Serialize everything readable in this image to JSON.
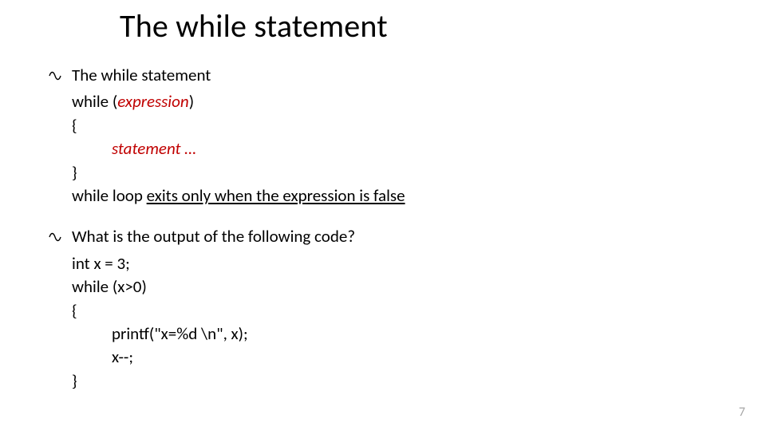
{
  "title": "The while statement",
  "bullets": {
    "b1": {
      "marker": "☐",
      "marker_glyph": "d",
      "text": "The while statement"
    },
    "b2": {
      "marker_glyph": "d",
      "text": "What is the output of the following code?"
    }
  },
  "syntax": {
    "while_open": "while (",
    "expression": "expression",
    "while_close": ")",
    "brace_open": "{",
    "statement_line": "statement …",
    "brace_close": "}",
    "exit_prefix": "while loop ",
    "exit_underlined": "exits only when the expression is false"
  },
  "code": {
    "l1": "int x = 3;",
    "l2": "while (x>0)",
    "l3": "{",
    "l4": "printf(\"x=%d \\n\", x);",
    "l5": "x--;",
    "l6": "}"
  },
  "page_number": "7"
}
